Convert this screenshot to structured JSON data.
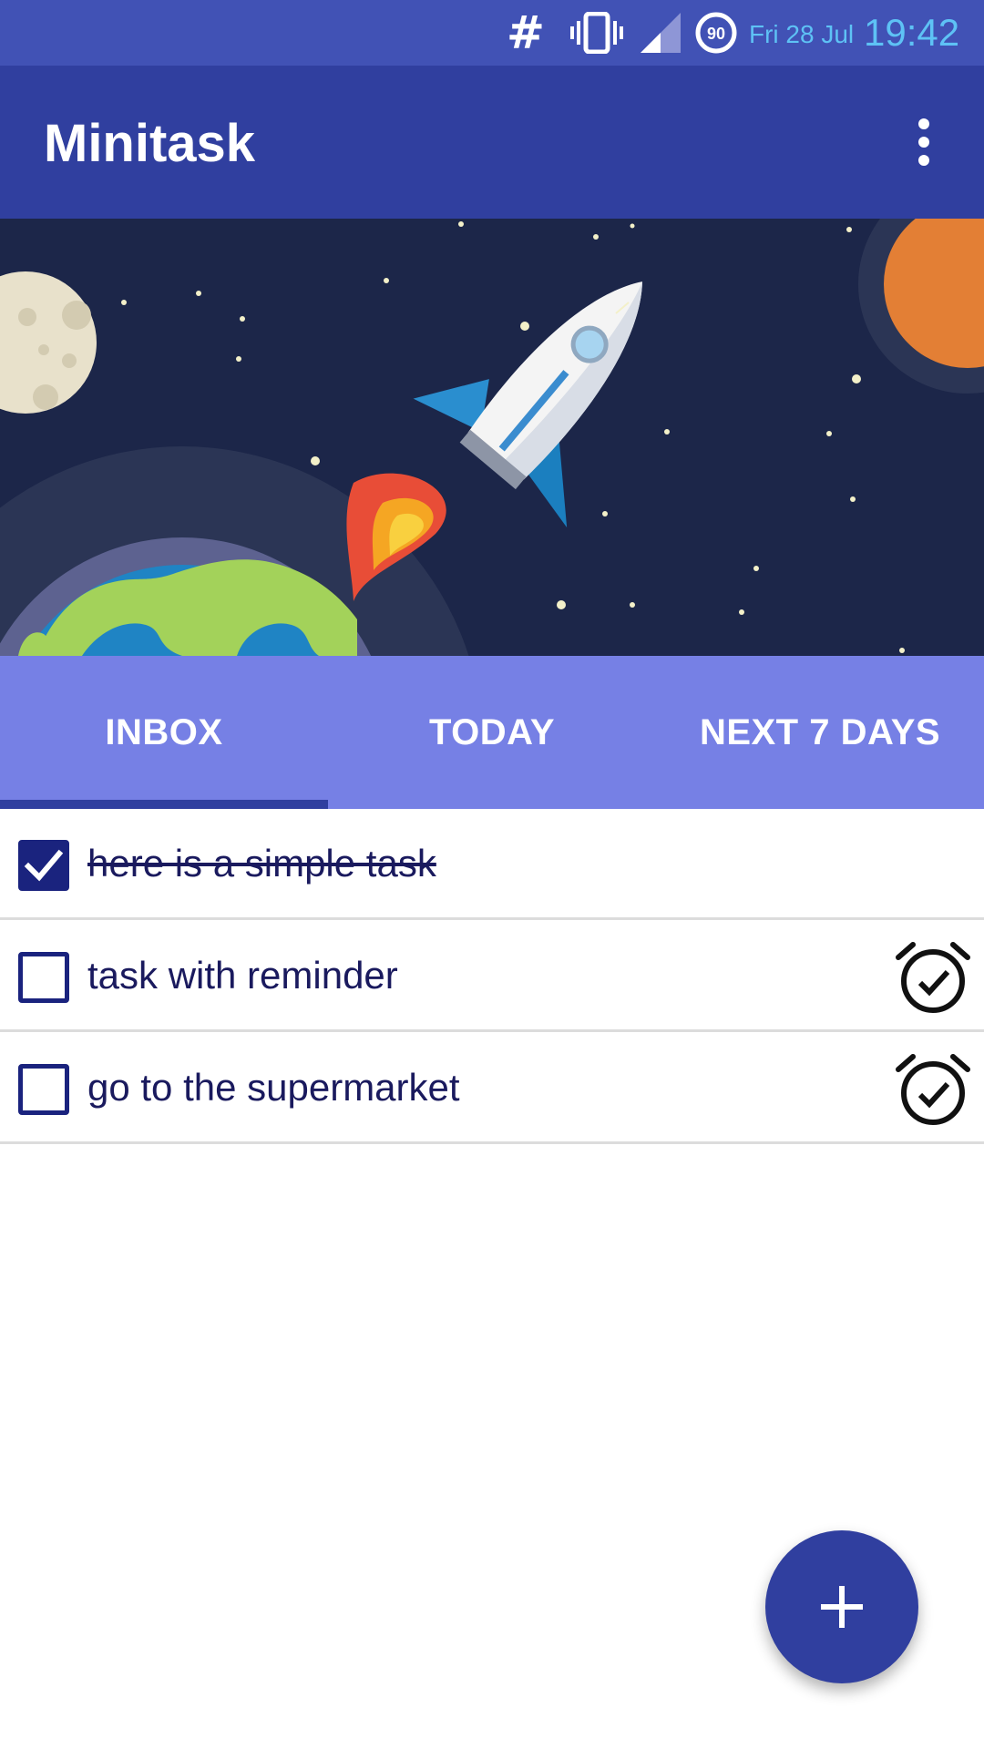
{
  "status_bar": {
    "icons": [
      "hash-icon",
      "vibrate-icon",
      "signal-icon",
      "battery-saver-icon"
    ],
    "battery_level": "90",
    "date": "Fri 28 Jul",
    "time": "19:42"
  },
  "app_bar": {
    "title": "Minitask",
    "menu_icon": "more-vert-icon"
  },
  "banner": {
    "description_icon": "rocket-space-illustration"
  },
  "tabs": [
    {
      "label": "INBOX",
      "selected": true
    },
    {
      "label": "TODAY",
      "selected": false
    },
    {
      "label": "NEXT 7 DAYS",
      "selected": false
    }
  ],
  "tasks": [
    {
      "text": "here is a simple task",
      "done": true,
      "has_reminder": false
    },
    {
      "text": "task with reminder",
      "done": false,
      "has_reminder": true
    },
    {
      "text": "go to the supermarket",
      "done": false,
      "has_reminder": true
    }
  ],
  "fab": {
    "icon": "plus-icon"
  },
  "colors": {
    "status_bar": "#4152b5",
    "primary": "#303f9f",
    "tab_bar": "#7680e5",
    "checkbox": "#1a237e",
    "clock_text": "#5ec2f5"
  }
}
